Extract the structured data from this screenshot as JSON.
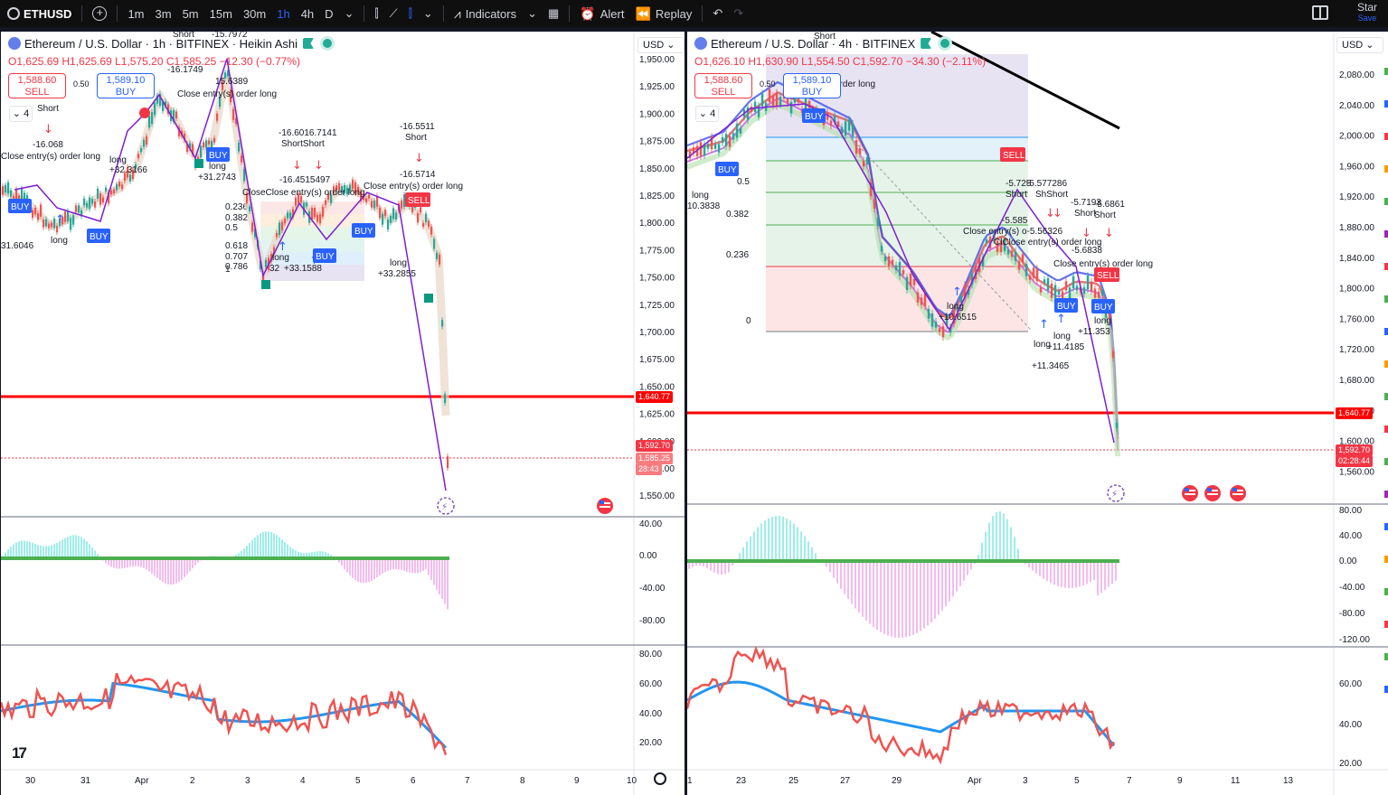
{
  "toolbar": {
    "symbol": "ETHUSD",
    "intervals": [
      "1m",
      "3m",
      "5m",
      "15m",
      "30m",
      "1h",
      "4h",
      "D"
    ],
    "active_interval": "1h",
    "indicators_label": "Indicators",
    "alert_label": "Alert",
    "replay_label": "Replay",
    "star_label": "Star",
    "save_label": "Save"
  },
  "left_chart": {
    "title": "Ethereum / U.S. Dollar · 1h · BITFINEX · Heikin Ashi",
    "ohlc": {
      "o": "O1,625.69",
      "h": "H1,625.69",
      "l": "L1,575.20",
      "c": "C1,585.25",
      "chg": "−12.30 (−0.77%)"
    },
    "sell_price": "1,588.60",
    "sell_label": "SELL",
    "buy_price": "1,589.10",
    "buy_label": "BUY",
    "spread": "0.50",
    "indicator_count": "4",
    "currency": "USD",
    "price_axis": [
      "1,950.00",
      "1,925.00",
      "1,900.00",
      "1,875.00",
      "1,850.00",
      "1,825.00",
      "1,800.00",
      "1,775.00",
      "1,750.00",
      "1,725.00",
      "1,700.00",
      "1,675.00",
      "1,650.00",
      "1,625.00",
      "1,600.00",
      "1,575.00",
      "1,550.00"
    ],
    "line_tag": "1,640.77",
    "last_price_tag": "1,592.70",
    "close_tag": "1,585.25",
    "countdown": "28:43",
    "macd_axis": [
      "40.00",
      "0.00",
      "-40.00",
      "-80.00"
    ],
    "rsi_axis": [
      "80.00",
      "60.00",
      "40.00",
      "20.00"
    ],
    "time_axis": [
      "30",
      "31",
      "Apr",
      "2",
      "3",
      "4",
      "5",
      "6",
      "7",
      "8",
      "9",
      "10"
    ],
    "fib_levels": [
      "0.236",
      "0.382",
      "0.5",
      "0.618",
      "0.707",
      "0.786",
      "1"
    ],
    "annotations": [
      {
        "text": "Short"
      },
      {
        "text": "-16.068"
      },
      {
        "text": "Close entry(s) order long"
      },
      {
        "text": "long"
      },
      {
        "text": "+32.3166"
      },
      {
        "text": "long"
      },
      {
        "text": "31.6046"
      },
      {
        "text": "-16.1749"
      },
      {
        "text": "Close entry(s) order long"
      },
      {
        "text": "Short"
      },
      {
        "text": "-15.7972"
      },
      {
        "text": "15.6389"
      },
      {
        "text": "long"
      },
      {
        "text": "+31.2743"
      },
      {
        "text": "-16.6016.7141"
      },
      {
        "text": "ShortShort"
      },
      {
        "text": "-16.4515497"
      },
      {
        "text": "CloseClose entry(s) order long"
      },
      {
        "text": "long"
      },
      {
        "text": "+33.1588"
      },
      {
        "text": "32"
      },
      {
        "text": "-16.5511"
      },
      {
        "text": "Short"
      },
      {
        "text": "-16.5714"
      },
      {
        "text": "Close entry(s) order long"
      },
      {
        "text": "long"
      },
      {
        "text": "+33.2855"
      }
    ]
  },
  "right_chart": {
    "title": "Ethereum / U.S. Dollar · 4h · BITFINEX",
    "ohlc": {
      "o": "O1,626.10",
      "h": "H1,630.90",
      "l": "L1,554.50",
      "c": "C1,592.70",
      "chg": "−34.30 (−2.11%)"
    },
    "sell_price": "1,588.60",
    "sell_label": "SELL",
    "buy_price": "1,589.10",
    "buy_label": "BUY",
    "spread": "0.50",
    "indicator_count": "4",
    "currency": "USD",
    "price_axis": [
      "2,080.00",
      "2,040.00",
      "2,000.00",
      "1,960.00",
      "1,920.00",
      "1,880.00",
      "1,840.00",
      "1,800.00",
      "1,760.00",
      "1,720.00",
      "1,680.00",
      "1,640.00",
      "1,600.00",
      "1,560.00"
    ],
    "line_tag": "1,640.77",
    "last_price_tag": "1,592.70",
    "countdown": "02:28:44",
    "macd_axis": [
      "80.00",
      "40.00",
      "0.00",
      "-40.00",
      "-80.00",
      "-120.00"
    ],
    "rsi_axis": [
      "60.00",
      "40.00",
      "20.00"
    ],
    "time_axis": [
      "1",
      "23",
      "25",
      "27",
      "29",
      "Apr",
      "3",
      "5",
      "7",
      "9",
      "11",
      "13"
    ],
    "fib_levels": [
      "0.5",
      "0.382",
      "0.236",
      "0"
    ],
    "annotations": [
      {
        "text": "Short"
      },
      {
        "text": "long"
      },
      {
        "text": "10.3838"
      },
      {
        "text": "order long"
      },
      {
        "text": "-5.725"
      },
      {
        "text": "Short"
      },
      {
        "text": "-5.577286"
      },
      {
        "text": "ShShort"
      },
      {
        "text": "-5.585"
      },
      {
        "text": "-5.7193"
      },
      {
        "text": "Short"
      },
      {
        "text": "-5.6861"
      },
      {
        "text": "Short"
      },
      {
        "text": "Close entry(s) o-5.56326"
      },
      {
        "text": "ClClose entry(s) order long"
      },
      {
        "text": "-5.6838"
      },
      {
        "text": "Close entry(s) order long"
      },
      {
        "text": "long"
      },
      {
        "text": "+10.6515"
      },
      {
        "text": "long"
      },
      {
        "text": "+11.4185"
      },
      {
        "text": "long"
      },
      {
        "text": "+11.3465"
      },
      {
        "text": "long"
      },
      {
        "text": "+11.353"
      }
    ]
  }
}
